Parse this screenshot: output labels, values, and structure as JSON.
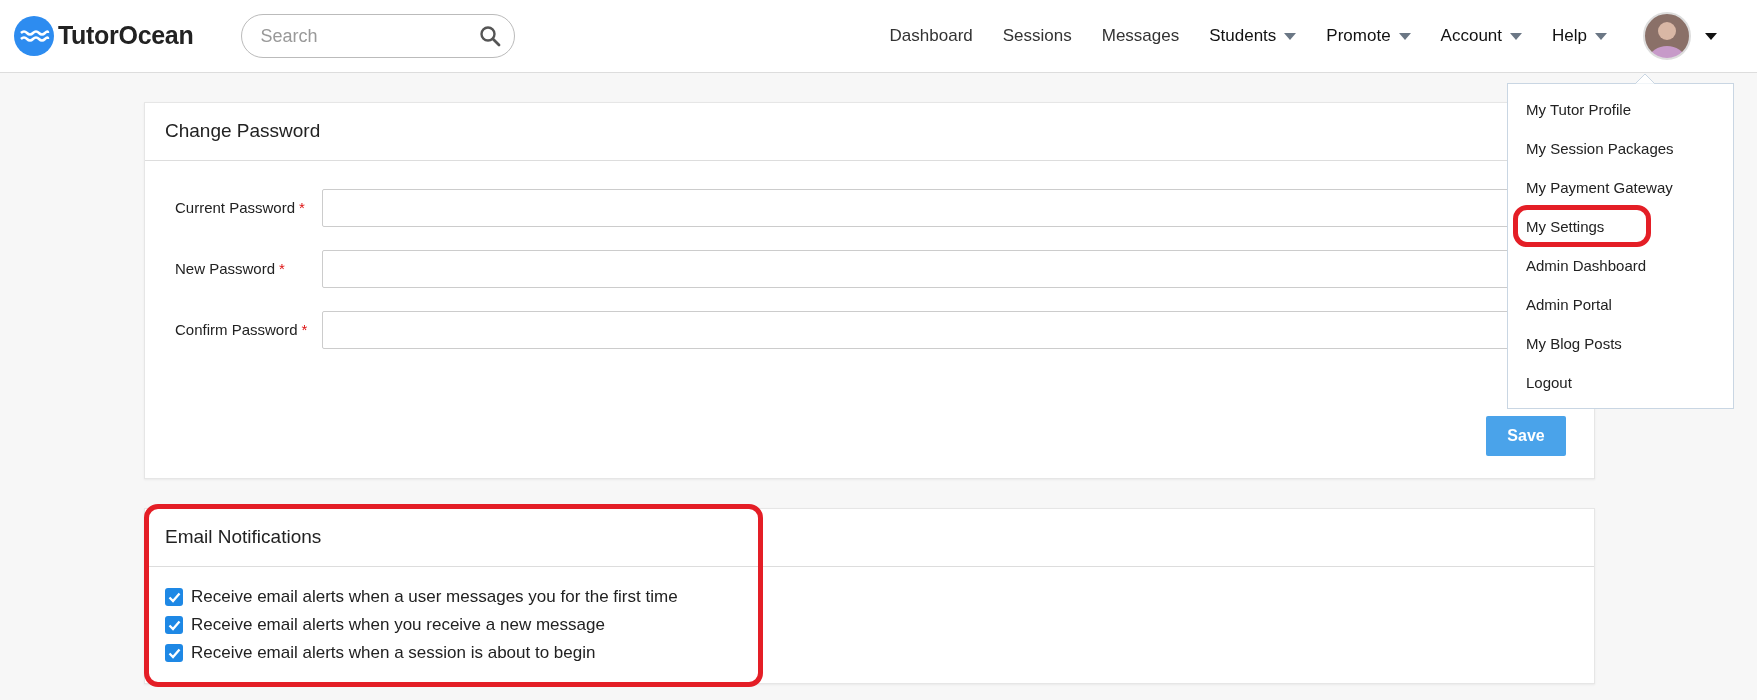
{
  "brand": {
    "name": "TutorOcean"
  },
  "search": {
    "placeholder": "Search"
  },
  "nav": [
    {
      "label": "Dashboard",
      "dropdown": false
    },
    {
      "label": "Sessions",
      "dropdown": false
    },
    {
      "label": "Messages",
      "dropdown": false
    },
    {
      "label": "Students",
      "dropdown": true
    },
    {
      "label": "Promote",
      "dropdown": true
    },
    {
      "label": "Account",
      "dropdown": true
    },
    {
      "label": "Help",
      "dropdown": true
    }
  ],
  "user_menu": {
    "expanded": true,
    "items": [
      {
        "label": "My Tutor Profile",
        "highlighted": false
      },
      {
        "label": "My Session Packages",
        "highlighted": false
      },
      {
        "label": "My Payment Gateway",
        "highlighted": false
      },
      {
        "label": "My Settings",
        "highlighted": true
      },
      {
        "label": "Admin Dashboard",
        "highlighted": false
      },
      {
        "label": "Admin Portal",
        "highlighted": false
      },
      {
        "label": "My Blog Posts",
        "highlighted": false
      },
      {
        "label": "Logout",
        "highlighted": false
      }
    ]
  },
  "change_password": {
    "title": "Change Password",
    "fields": [
      {
        "label": "Current Password",
        "required_mark": "*"
      },
      {
        "label": "New Password",
        "required_mark": "*"
      },
      {
        "label": "Confirm Password",
        "required_mark": "*"
      }
    ],
    "save_button": "Save"
  },
  "email_notifications": {
    "title": "Email Notifications",
    "highlighted": true,
    "options": [
      {
        "label": "Receive email alerts when a user messages you for the first time",
        "checked": true
      },
      {
        "label": "Receive email alerts when you receive a new message",
        "checked": true
      },
      {
        "label": "Receive email alerts when a session is about to begin",
        "checked": true
      }
    ]
  }
}
